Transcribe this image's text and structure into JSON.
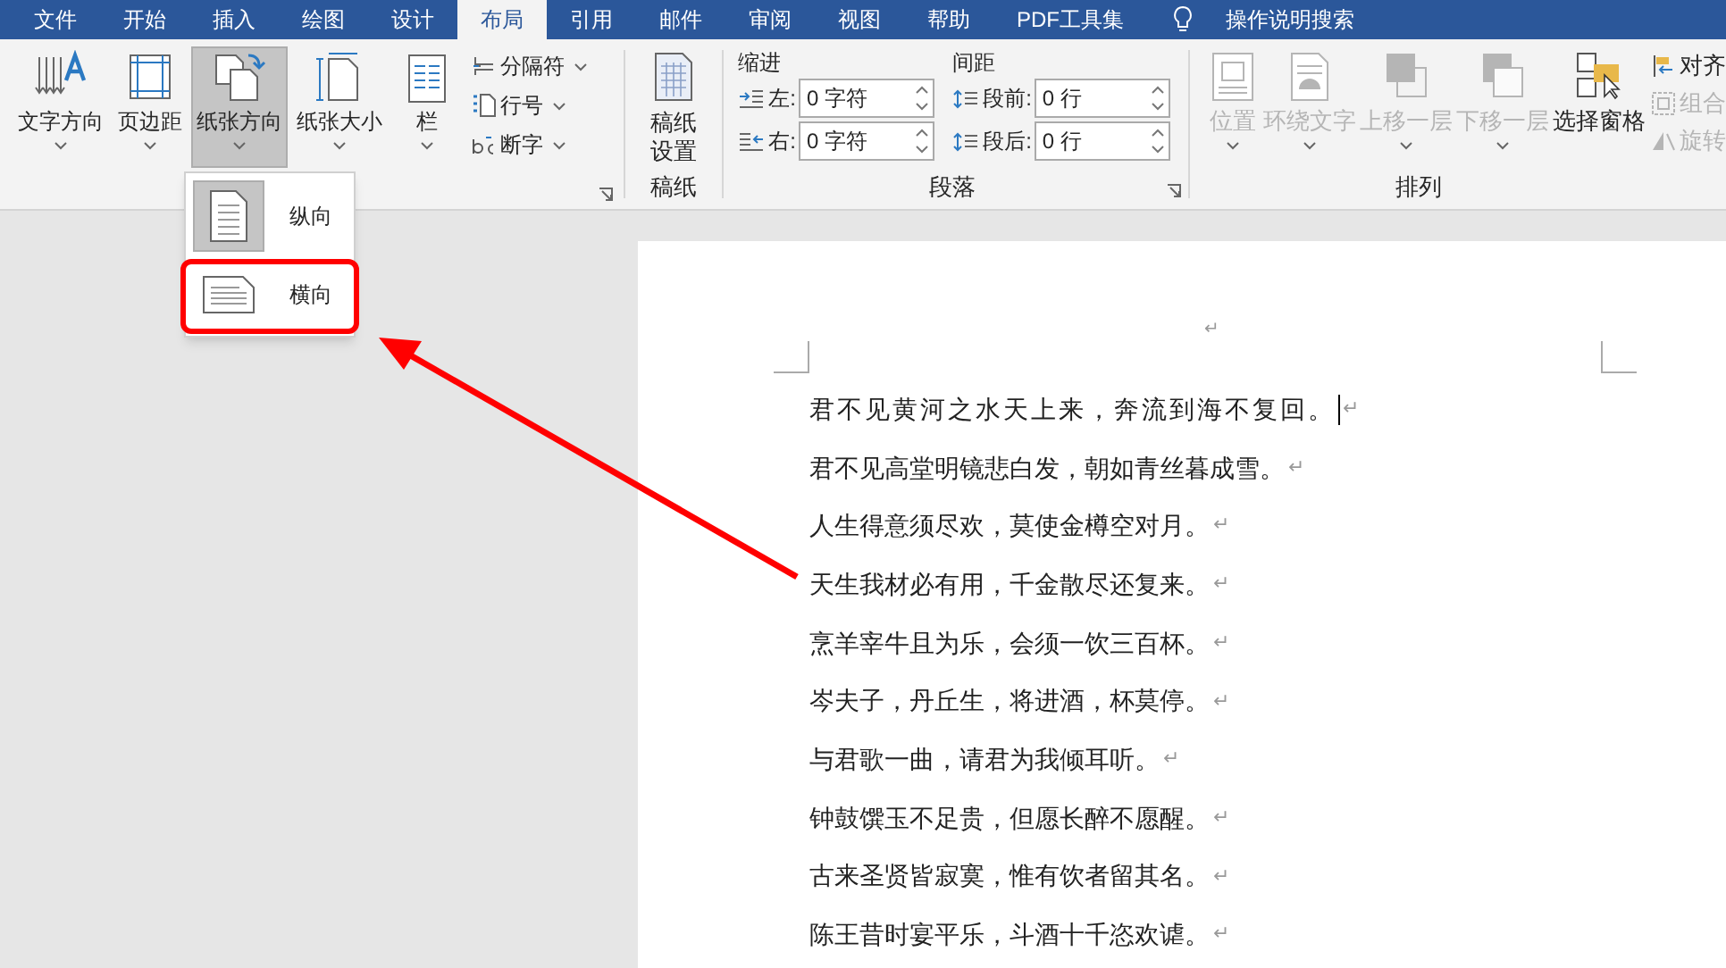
{
  "tabs": [
    {
      "label": "文件",
      "selected": false
    },
    {
      "label": "开始",
      "selected": false
    },
    {
      "label": "插入",
      "selected": false
    },
    {
      "label": "绘图",
      "selected": false
    },
    {
      "label": "设计",
      "selected": false
    },
    {
      "label": "布局",
      "selected": true
    },
    {
      "label": "引用",
      "selected": false
    },
    {
      "label": "邮件",
      "selected": false
    },
    {
      "label": "审阅",
      "selected": false
    },
    {
      "label": "视图",
      "selected": false
    },
    {
      "label": "帮助",
      "selected": false
    },
    {
      "label": "PDF工具集",
      "selected": false
    }
  ],
  "tell_me": {
    "label": "操作说明搜索"
  },
  "page_setup": {
    "large_buttons": [
      {
        "label": "文字方向",
        "pressed": false
      },
      {
        "label": "页边距",
        "pressed": false
      },
      {
        "label": "纸张方向",
        "pressed": true
      },
      {
        "label": "纸张大小",
        "pressed": false
      },
      {
        "label": "栏",
        "pressed": false
      }
    ],
    "small_buttons": [
      {
        "label": "分隔符"
      },
      {
        "label": "行号"
      },
      {
        "label": "断字"
      }
    ]
  },
  "manuscript": {
    "label": "稿纸",
    "button": "稿纸设置"
  },
  "paragraph": {
    "label": "段落",
    "indent_title": "缩进",
    "spacing_title": "间距",
    "indent": [
      {
        "label": "左:",
        "value": "0 字符"
      },
      {
        "label": "右:",
        "value": "0 字符"
      }
    ],
    "spacing": [
      {
        "label": "段前:",
        "value": "0 行"
      },
      {
        "label": "段后:",
        "value": "0 行"
      }
    ]
  },
  "arrange": {
    "label": "排列",
    "large_buttons": [
      {
        "label": "位置",
        "disabled": true
      },
      {
        "label": "环绕文字",
        "disabled": true
      },
      {
        "label": "上移一层",
        "disabled": true
      },
      {
        "label": "下移一层",
        "disabled": true
      },
      {
        "label": "选择窗格",
        "disabled": false
      }
    ],
    "small_buttons": [
      {
        "label": "对齐",
        "disabled": false
      },
      {
        "label": "组合",
        "disabled": true
      },
      {
        "label": "旋转",
        "disabled": true
      }
    ]
  },
  "orientation_menu": {
    "items": [
      {
        "label": "纵向",
        "selected": true
      },
      {
        "label": "横向",
        "selected": false
      }
    ]
  },
  "document": {
    "header_mark": "↵",
    "paragraphs": [
      {
        "text": "君不见黄河之水天上来，奔流到海不复回。",
        "mark": "↵",
        "cursor": true
      },
      {
        "text": "君不见高堂明镜悲白发，朝如青丝暮成雪。",
        "mark": "↵",
        "cursor": false
      },
      {
        "text": "人生得意须尽欢，莫使金樽空对月。",
        "mark": "↵",
        "cursor": false
      },
      {
        "text": "天生我材必有用，千金散尽还复来。",
        "mark": "↵",
        "cursor": false
      },
      {
        "text": "烹羊宰牛且为乐，会须一饮三百杯。",
        "mark": "↵",
        "cursor": false
      },
      {
        "text": "岑夫子，丹丘生，将进酒，杯莫停。",
        "mark": "↵",
        "cursor": false
      },
      {
        "text": "与君歌一曲，请君为我倾耳听。",
        "mark": "↵",
        "cursor": false
      },
      {
        "text": "钟鼓馔玉不足贵，但愿长醉不愿醒。",
        "mark": "↵",
        "cursor": false
      },
      {
        "text": "古来圣贤皆寂寞，惟有饮者留其名。",
        "mark": "↵",
        "cursor": false
      },
      {
        "text": "陈王昔时宴平乐，斗酒十千恣欢谑。",
        "mark": "↵",
        "cursor": false
      }
    ]
  },
  "annotations": [
    {
      "kind": "highlight"
    },
    {
      "kind": "arrow"
    }
  ]
}
